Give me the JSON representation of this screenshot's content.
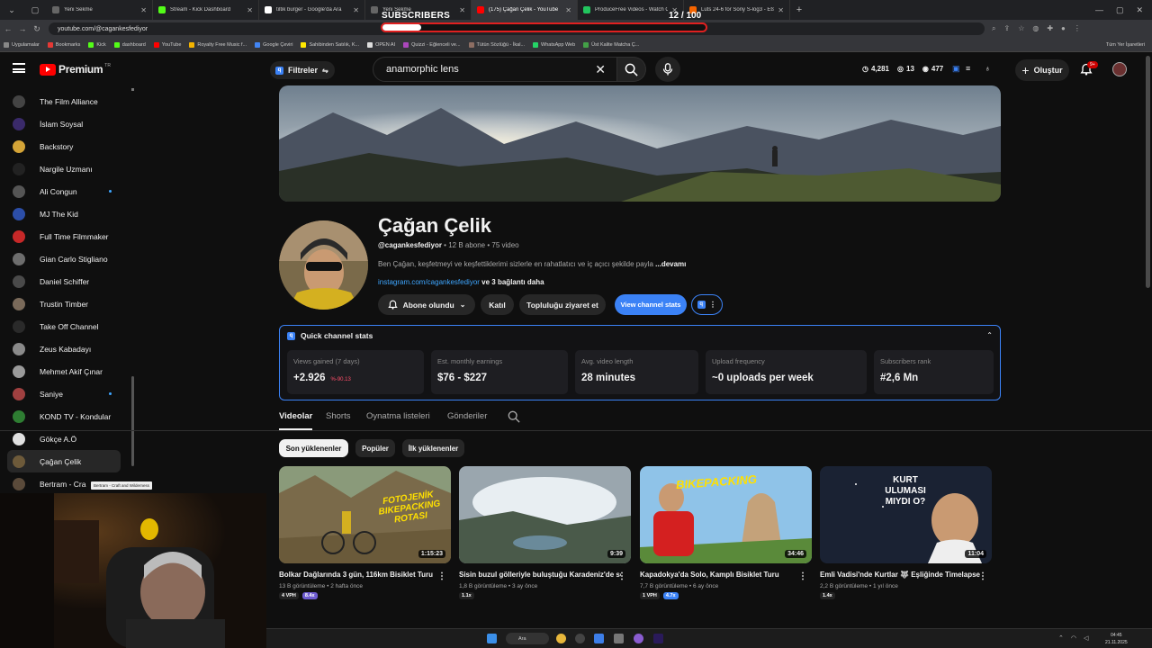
{
  "browser": {
    "tabs": [
      {
        "label": "Yeni Sekme",
        "color": "#666666"
      },
      {
        "label": "Stream - Kick Dashboard",
        "color": "#53fc18"
      },
      {
        "label": "tiltik burger - Google'da Ara",
        "color": "#ffffff"
      },
      {
        "label": "Yeni Sekme",
        "color": "#666666"
      },
      {
        "label": "(175) Çağan Çelik - YouTube",
        "color": "#ff0000"
      },
      {
        "label": "ProduceFree Videos - Watch O...",
        "color": "#22c55e"
      },
      {
        "label": "Luts 24-6 for Sony S-log3 - Etsy",
        "color": "#f56400"
      }
    ],
    "active_tab": 4,
    "url": "youtube.com/@cagankesfediyor",
    "bookmarks": [
      {
        "label": "Uygulamalar",
        "color": "#888888"
      },
      {
        "label": "Bookmarks",
        "color": "#e53935"
      },
      {
        "label": "Kick",
        "color": "#53fc18"
      },
      {
        "label": "dashboard",
        "color": "#53fc18"
      },
      {
        "label": "YouTube",
        "color": "#ff0000"
      },
      {
        "label": "Royalty Free Music f...",
        "color": "#f5b400"
      },
      {
        "label": "Google Çeviri",
        "color": "#4285f4"
      },
      {
        "label": "Sahibinden Satılık, K...",
        "color": "#ffe800"
      },
      {
        "label": "OPEN AI",
        "color": "#dddddd"
      },
      {
        "label": "Quizzi - Eğlenceli ve...",
        "color": "#ab47bc"
      },
      {
        "label": "Tütün Sözlüğü - İkal...",
        "color": "#8d6e63"
      },
      {
        "label": "WhatsApp Web",
        "color": "#25d366"
      },
      {
        "label": "Üst Kalite Matcha Ç...",
        "color": "#43a047"
      }
    ],
    "bookmarks_right": "Tüm Yer İşaretleri"
  },
  "overlay": {
    "label": "SUBSCRIBERS",
    "count_text": "12  / 100",
    "progress_fraction": 0.12
  },
  "header": {
    "logo_word": "Premium",
    "logo_tr": "TR",
    "filters_label": "Filtreler",
    "search_value": "anamorphic lens",
    "ext_stats": [
      "4,281",
      "13",
      "477"
    ],
    "create_label": "Oluştur",
    "notif_badge": "9+"
  },
  "sidebar": {
    "items": [
      {
        "label": "The Film Alliance",
        "color": "#444444",
        "dot": false
      },
      {
        "label": "İslam Soysal",
        "color": "#3a2a6a",
        "dot": false
      },
      {
        "label": "Backstory",
        "color": "#d4a437",
        "dot": false
      },
      {
        "label": "Nargile Uzmanı",
        "color": "#222222",
        "dot": false
      },
      {
        "label": "Ali Congun",
        "color": "#555555",
        "dot": true
      },
      {
        "label": "MJ The Kid",
        "color": "#2c4ea8",
        "dot": false
      },
      {
        "label": "Full Time Filmmaker",
        "color": "#c62828",
        "dot": false
      },
      {
        "label": "Gian Carlo Stigliano",
        "color": "#6d6d6d",
        "dot": false
      },
      {
        "label": "Daniel Schiffer",
        "color": "#4a4a4a",
        "dot": false
      },
      {
        "label": "Trustin Timber",
        "color": "#7a6a5a",
        "dot": false
      },
      {
        "label": "Take Off Channel",
        "color": "#2a2a2a",
        "dot": false
      },
      {
        "label": "Zeus Kabadayı",
        "color": "#8a8a8a",
        "dot": false
      },
      {
        "label": "Mehmet Akif Çınar",
        "color": "#9a9a9a",
        "dot": false
      },
      {
        "label": "Saniye",
        "color": "#a04040",
        "dot": true
      },
      {
        "label": "KOND TV - Kondular",
        "color": "#2e7d32",
        "dot": false
      },
      {
        "label": "Gökçe A.Ö",
        "color": "#e0e0e0",
        "dot": false
      },
      {
        "label": "Çağan Çelik",
        "color": "#6d5a3a",
        "dot": false
      },
      {
        "label": "Bertram - Cra",
        "color": "#5a4a3a",
        "dot": false
      }
    ],
    "active_index": 16,
    "tooltip": "Bertram - Craft and Wilderness"
  },
  "channel": {
    "name": "Çağan Çelik",
    "handle": "@cagankesfediyor",
    "meta_rest": " • 12 B abone • 75 video",
    "description": "Ben Çağan, keşfetmeyi ve keşfettiklerimi sizlerle en rahatlatıcı ve iç açıcı şekilde payla",
    "more_label": "...devamı",
    "link": "instagram.com/cagankesfediyor",
    "link_more": " ve 3 bağlantı daha",
    "buttons": {
      "subscribed": "Abone olundu",
      "join": "Katıl",
      "community": "Topluluğu ziyaret et",
      "stats": "View channel stats"
    }
  },
  "quick_stats": {
    "title": "Quick channel stats",
    "cards": [
      {
        "label": "Views gained (7 days)",
        "value": "+2.926",
        "sub": "%-90.13"
      },
      {
        "label": "Est. monthly earnings",
        "value": "$76 - $227",
        "sub": ""
      },
      {
        "label": "Avg. video length",
        "value": "28 minutes",
        "sub": ""
      },
      {
        "label": "Upload frequency",
        "value": "~0 uploads per week",
        "sub": ""
      },
      {
        "label": "Subscribers rank",
        "value": "#2,6 Mn",
        "sub": ""
      }
    ]
  },
  "tabs": [
    "Videolar",
    "Shorts",
    "Oynatma listeleri",
    "Gönderiler"
  ],
  "chips": [
    "Son yüklenenler",
    "Popüler",
    "İlk yüklenenler"
  ],
  "videos": [
    {
      "title": "Bolkar Dağlarında 3 gün, 116km Bisiklet Turu",
      "views": "13 B görüntüleme",
      "age": "2 hafta önce",
      "duration": "1:15:23",
      "badges": [
        "4 VPH",
        "8.4x"
      ],
      "thumb_text": "FOTOJENİK BIKEPACKING ROTASI"
    },
    {
      "title": "Sisin buzul gölleriyle buluştuğu Karadeniz'de solo doğa yürüyüşü",
      "views": "1,8 B görüntüleme",
      "age": "3 ay önce",
      "duration": "9:39",
      "badges": [
        "1.1x"
      ],
      "thumb_text": ""
    },
    {
      "title": "Kapadokya'da Solo, Kamplı Bisiklet Turu",
      "views": "7,7 B görüntüleme",
      "age": "6 ay önce",
      "duration": "34:46",
      "badges": [
        "1 VPH",
        "4.7x"
      ],
      "thumb_text": "BIKEPACKING"
    },
    {
      "title": "Emli Vadisi'nde Kurtlar 🐺 Eşliğinde Timelapse Çektim",
      "views": "2,2 B görüntüleme",
      "age": "1 yıl önce",
      "duration": "11:04",
      "badges": [
        "1.4x"
      ],
      "thumb_text": "KURT ULUMASI MIYDI O?"
    }
  ],
  "taskbar": {
    "search_label": "Ara",
    "time": "04:45",
    "date": "21.11.2025"
  }
}
